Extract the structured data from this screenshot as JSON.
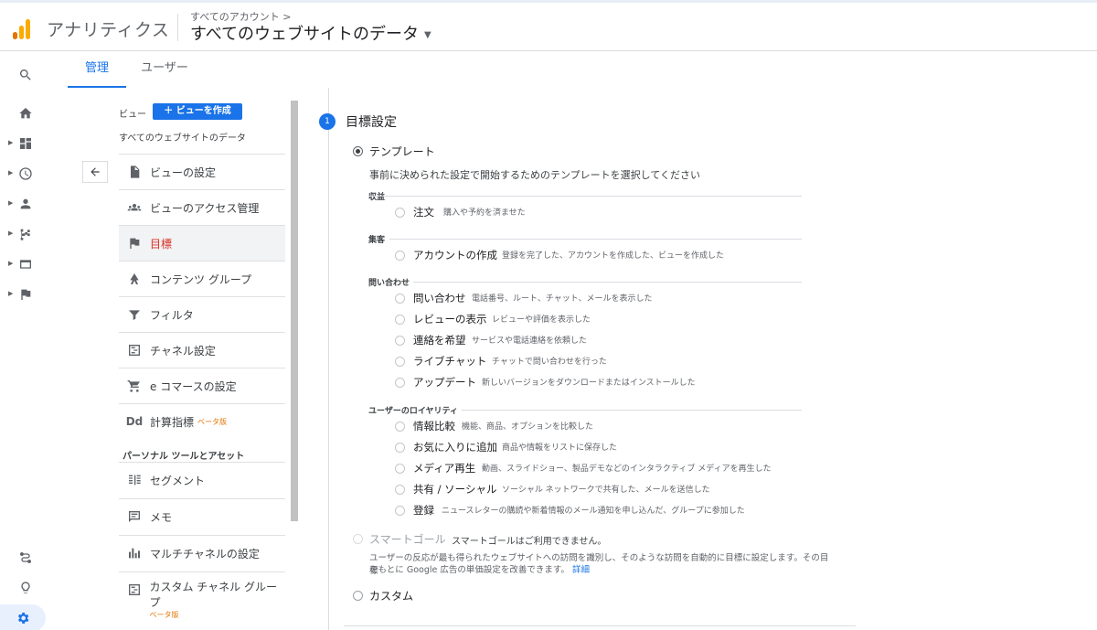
{
  "header": {
    "product": "アナリティクス",
    "breadcrumb": "すべてのアカウント >",
    "account": "すべてのウェブサイトのデータ",
    "logo_colors": [
      "#f9ab00",
      "#e37400",
      "#e37400"
    ]
  },
  "rail": {
    "items": [
      "search-icon",
      "home-icon",
      "dashboard-icon",
      "clock-icon",
      "person-icon",
      "flow-icon",
      "display-icon",
      "flag-icon"
    ],
    "bottom_items": [
      "route-icon",
      "lightbulb-icon",
      "gear-icon"
    ]
  },
  "tabs": [
    {
      "label": "管理",
      "active": true
    },
    {
      "label": "ユーザー",
      "active": false
    }
  ],
  "menu": {
    "view_label": "ビュー",
    "create_button": "ビューを作成",
    "view_name": "すべてのウェブサイトのデータ",
    "items": [
      {
        "label": "ビューの設定",
        "icon": "file-icon"
      },
      {
        "label": "ビューのアクセス管理",
        "icon": "people-icon"
      },
      {
        "label": "目標",
        "icon": "flag-icon",
        "active": true
      },
      {
        "label": "コンテンツ グループ",
        "icon": "content-group-icon"
      },
      {
        "label": "フィルタ",
        "icon": "filter-icon"
      },
      {
        "label": "チャネル設定",
        "icon": "channel-icon"
      },
      {
        "label": "e コマースの設定",
        "icon": "cart-icon"
      },
      {
        "label": "計算指標",
        "icon": "dd-icon",
        "beta": "ベータ版"
      }
    ],
    "personal_section": "パーソナル ツールとアセット",
    "personal_items": [
      {
        "label": "セグメント",
        "icon": "segment-icon"
      },
      {
        "label": "メモ",
        "icon": "memo-icon"
      },
      {
        "label": "マルチチャネルの設定",
        "icon": "bar-chart-icon"
      },
      {
        "label": "カスタム チャネル グループ",
        "icon": "channel-icon",
        "beta": "ベータ版"
      }
    ]
  },
  "goals": {
    "step": "1",
    "title": "目標設定",
    "template_label": "テンプレート",
    "template_desc": "事前に決められた設定で開始するためのテンプレートを選択してください",
    "categories": [
      {
        "name": "収益",
        "items": [
          {
            "name": "注文",
            "desc": "購入や予約を済ませた"
          }
        ]
      },
      {
        "name": "集客",
        "items": [
          {
            "name": "アカウントの作成",
            "desc": "登録を完了した、アカウントを作成した、ビューを作成した"
          }
        ]
      },
      {
        "name": "問い合わせ",
        "items": [
          {
            "name": "問い合わせ",
            "desc": "電話番号、ルート、チャット、メールを表示した"
          },
          {
            "name": "レビューの表示",
            "desc": "レビューや評価を表示した"
          },
          {
            "name": "連絡を希望",
            "desc": "サービスや電話連絡を依頼した"
          },
          {
            "name": "ライブチャット",
            "desc": "チャットで問い合わせを行った"
          },
          {
            "name": "アップデート",
            "desc": "新しいバージョンをダウンロードまたはインストールした"
          }
        ]
      },
      {
        "name": "ユーザーのロイヤリティ",
        "items": [
          {
            "name": "情報比較",
            "desc": "機能、商品、オプションを比較した"
          },
          {
            "name": "お気に入りに追加",
            "desc": "商品や情報をリストに保存した"
          },
          {
            "name": "メディア再生",
            "desc": "動画、スライドショー、製品デモなどのインタラクティブ メディアを再生した"
          },
          {
            "name": "共有 / ソーシャル",
            "desc": "ソーシャル ネットワークで共有した、メールを送信した"
          },
          {
            "name": "登録",
            "desc": "ニュースレターの購読や新着情報のメール通知を申し込んだ、グループに参加した"
          }
        ]
      }
    ],
    "smart_label": "スマートゴール",
    "smart_unavailable": "スマートゴールはご利用できません。",
    "smart_desc_1": "ユーザーの反応が最も得られたウェブサイトへの訪問を識別し、そのような訪問を自動的に目標に設定します。その目標",
    "smart_desc_2": "をもとに Google 広告の単価設定を改善できます。",
    "smart_link": "詳細",
    "custom_label": "カスタム"
  }
}
